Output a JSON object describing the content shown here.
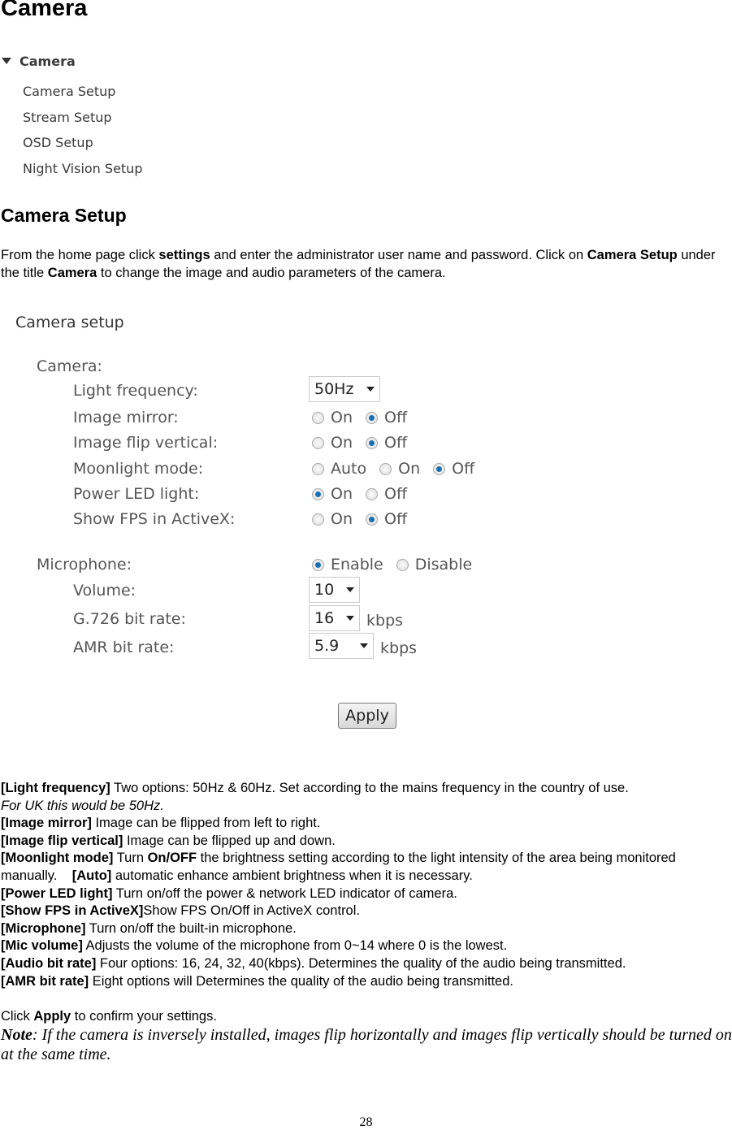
{
  "title": "Camera",
  "nav": {
    "header": "Camera",
    "items": [
      "Camera Setup",
      "Stream Setup",
      "OSD Setup",
      "Night Vision Setup"
    ]
  },
  "section_title": "Camera Setup",
  "intro": {
    "t1": "From the home page click ",
    "b1": "settings",
    "t2": " and enter the administrator user name and password. Click on ",
    "b2": "Camera Setup",
    "t3": " under the title ",
    "b3": "Camera",
    "t4": " to change the image and audio parameters of the camera."
  },
  "panel": {
    "title": "Camera setup",
    "camera_group": "Camera:",
    "light_frequency": {
      "label": "Light frequency:",
      "value": "50Hz"
    },
    "image_mirror": {
      "label": "Image mirror:",
      "options": [
        "On",
        "Off"
      ],
      "selected": "Off"
    },
    "image_flip": {
      "label": "Image flip vertical:",
      "options": [
        "On",
        "Off"
      ],
      "selected": "Off"
    },
    "moonlight": {
      "label": "Moonlight mode:",
      "options": [
        "Auto",
        "On",
        "Off"
      ],
      "selected": "Off"
    },
    "power_led": {
      "label": "Power LED light:",
      "options": [
        "On",
        "Off"
      ],
      "selected": "On"
    },
    "show_fps": {
      "label": "Show FPS in ActiveX:",
      "options": [
        "On",
        "Off"
      ],
      "selected": "Off"
    },
    "microphone": {
      "label": "Microphone:",
      "options": [
        "Enable",
        "Disable"
      ],
      "selected": "Enable"
    },
    "volume": {
      "label": "Volume:",
      "value": "10"
    },
    "g726": {
      "label": "G.726 bit rate:",
      "value": "16",
      "unit": "kbps"
    },
    "amr": {
      "label": "AMR bit rate:",
      "value": "5.9",
      "unit": "kbps"
    },
    "apply": "Apply",
    "accent": "#1a6fb0"
  },
  "desc": [
    {
      "b": "[Light frequency]",
      "t": " Two options: 50Hz & 60Hz. Set according to the mains frequency in the country of use."
    },
    {
      "i": "For UK this would be 50Hz."
    },
    {
      "b": "[Image mirror]",
      "t": " Image can be flipped from left to right."
    },
    {
      "b": "[Image flip vertical]",
      "t": " Image can be flipped up and down."
    },
    {
      "b": "[Moonlight mode]",
      "t": " Turn ",
      "b2": "On/OFF",
      "t2": " the brightness setting according to the light intensity of the area being monitored manually.    ",
      "b3": "[Auto]",
      "t3": " automatic enhance ambient brightness when it is necessary."
    },
    {
      "b": "[Power LED light]",
      "t": " Turn on/off the power & network LED indicator of camera."
    },
    {
      "b": "[Show FPS in ActiveX]",
      "t": "Show FPS On/Off in ActiveX control."
    },
    {
      "b": "[Microphone]",
      "t": " Turn on/off the built-in microphone."
    },
    {
      "b": "[Mic volume]",
      "t": " Adjusts the volume of the microphone from 0~14 where 0 is the lowest."
    },
    {
      "b": "[Audio bit rate]",
      "t": " Four options: 16, 24, 32, 40(kbps). Determines the quality of the audio being transmitted."
    },
    {
      "b": "[AMR bit rate]",
      "t": " Eight options will Determines the quality of the audio being transmitted."
    }
  ],
  "confirm": {
    "t1": "Click ",
    "b": "Apply",
    "t2": " to confirm your settings."
  },
  "note": {
    "label": "Note",
    "text": ": If the camera is inversely installed, images flip horizontally and images flip vertically should be turned on at the same time."
  },
  "page_number": "28"
}
